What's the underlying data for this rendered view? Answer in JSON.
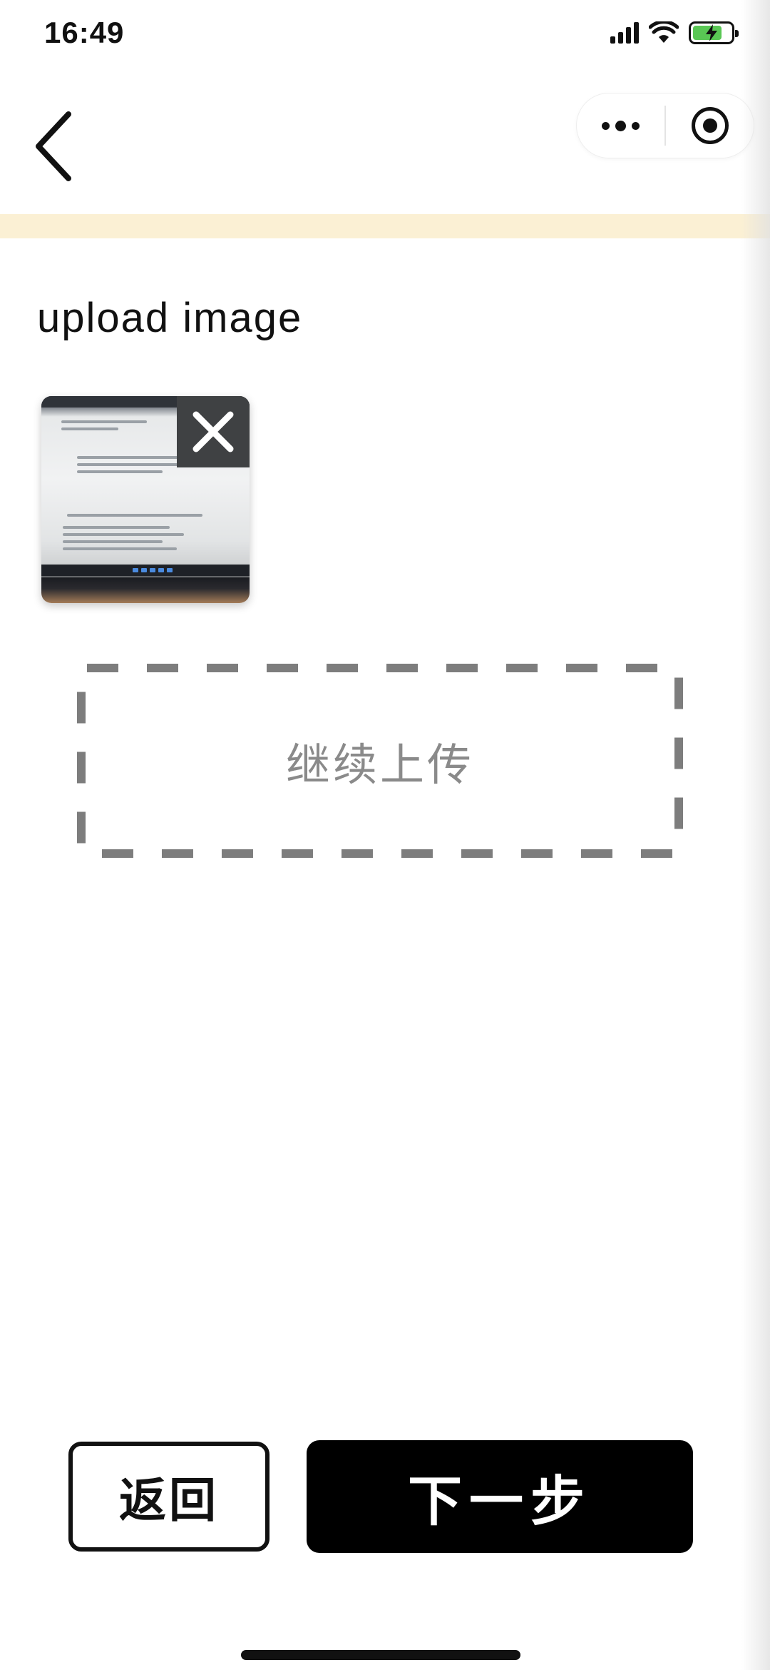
{
  "status_bar": {
    "time": "16:49",
    "icons": [
      "signal-icon",
      "wifi-icon",
      "battery-charging-icon"
    ],
    "battery_color": "#59c754"
  },
  "nav": {
    "back_icon": "chevron-left-icon",
    "capsule_more_icon": "more-dots-icon",
    "capsule_close_icon": "target-circle-icon"
  },
  "notice_strip_color": "#fbf0d4",
  "upload": {
    "title": "upload image",
    "thumbnail_remove_icon": "close-icon",
    "continue_label": "继续上传"
  },
  "footer": {
    "back_label": "返回",
    "next_label": "下一步"
  }
}
